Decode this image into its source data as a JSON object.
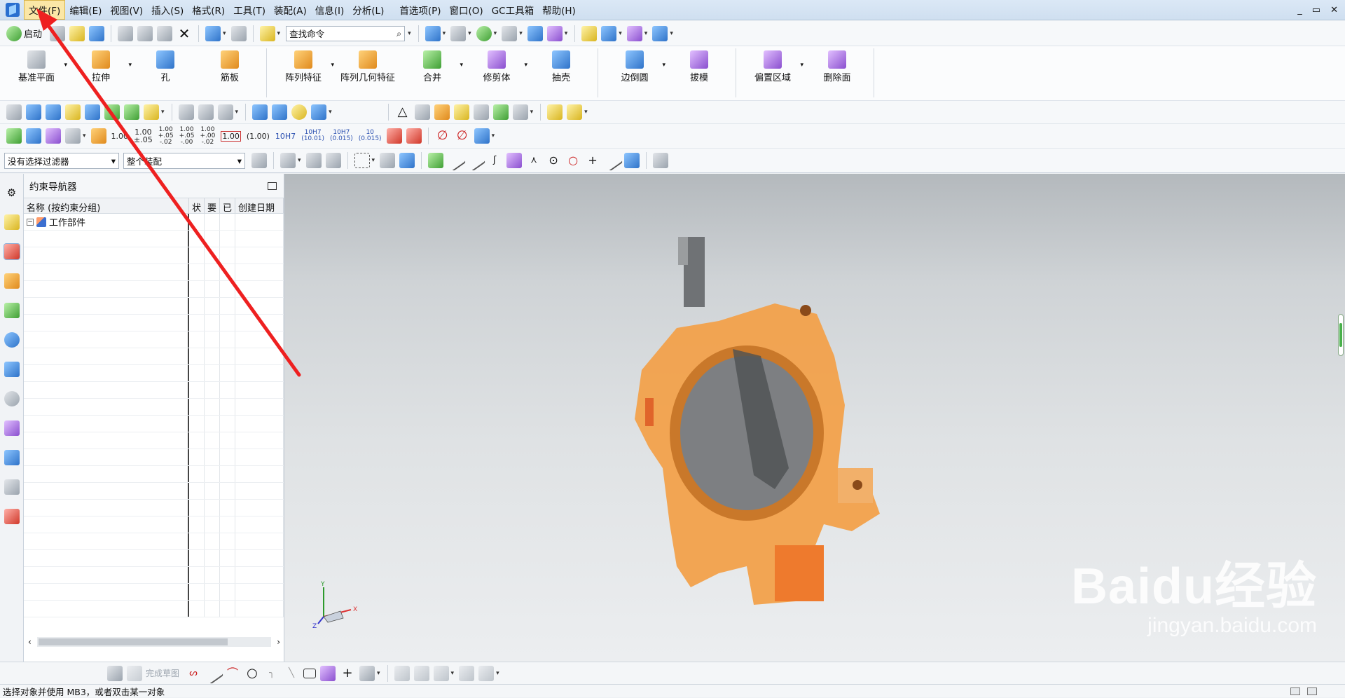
{
  "menubar": {
    "items": [
      "文件(F)",
      "编辑(E)",
      "视图(V)",
      "插入(S)",
      "格式(R)",
      "工具(T)",
      "装配(A)",
      "信息(I)",
      "分析(L)",
      "首选项(P)",
      "窗口(O)",
      "GC工具箱",
      "帮助(H)"
    ],
    "window_controls": [
      "_",
      "▭",
      "✕"
    ]
  },
  "toolbar1": {
    "start_label": "启动",
    "search_placeholder": "查找命令",
    "search_icon": "magnifier-icon"
  },
  "ribbon": {
    "buttons": [
      {
        "label": "基准平面",
        "icon": "datum-plane-icon"
      },
      {
        "label": "拉伸",
        "icon": "extrude-icon"
      },
      {
        "label": "孔",
        "icon": "hole-icon"
      },
      {
        "label": "筋板",
        "icon": "rib-icon"
      },
      {
        "label": "阵列特征",
        "icon": "pattern-feature-icon"
      },
      {
        "label": "阵列几何特征",
        "icon": "pattern-geometry-icon"
      },
      {
        "label": "合并",
        "icon": "unite-icon"
      },
      {
        "label": "修剪体",
        "icon": "trim-body-icon"
      },
      {
        "label": "抽壳",
        "icon": "shell-icon"
      },
      {
        "label": "边倒圆",
        "icon": "edge-blend-icon"
      },
      {
        "label": "拔模",
        "icon": "draft-icon"
      },
      {
        "label": "偏置区域",
        "icon": "offset-region-icon"
      },
      {
        "label": "删除面",
        "icon": "delete-face-icon"
      }
    ]
  },
  "dimensions": {
    "values": [
      "1.00",
      "1.00\n±.05",
      "1.00\n+.05\n-.02",
      "1.00\n+.05\n-.00",
      "1.00\n+.00\n-.02",
      "1.00",
      "(1.00)",
      "10H7",
      "10H7\n(10.01)",
      "10H7\n(0.015)",
      "10\n(0.015)"
    ]
  },
  "filters": {
    "selection_filter": "没有选择过滤器",
    "assembly_scope": "整个装配"
  },
  "navigator": {
    "title": "约束导航器",
    "columns": [
      "名称 (按约束分组)",
      "状",
      "要",
      "已",
      "创建日期"
    ],
    "root_item": "工作部件",
    "scroll_left": "‹",
    "scroll_right": "›"
  },
  "viewport": {
    "axis_x": "X",
    "axis_y": "Y",
    "axis_z": "Z"
  },
  "sketchbar": {
    "finish_sketch_label": "完成草图"
  },
  "status": {
    "message": "选择对象并使用 MB3，或者双击某一对象"
  },
  "watermark": {
    "brand": "Baidu经验",
    "url": "jingyan.baidu.com"
  },
  "colors": {
    "menubar_bg": "#d5e4f4",
    "active_menu_bg": "#fbe7a6",
    "model_orange": "#f2a14b",
    "model_gray": "#7d7f82",
    "annotation_red": "#ee2020"
  }
}
